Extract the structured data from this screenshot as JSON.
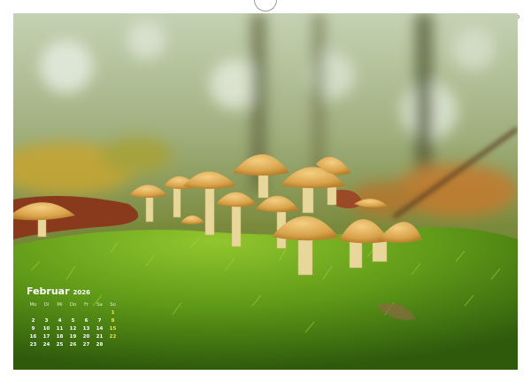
{
  "calendar": {
    "month": "Februar",
    "year": "2026",
    "weekdays": [
      "Mo",
      "Di",
      "Mi",
      "Do",
      "Fr",
      "Sa",
      "So"
    ],
    "weeks": [
      [
        "",
        "",
        "",
        "",
        "",
        "",
        "1"
      ],
      [
        "2",
        "3",
        "4",
        "5",
        "6",
        "7",
        "8"
      ],
      [
        "9",
        "10",
        "11",
        "12",
        "13",
        "14",
        "15"
      ],
      [
        "16",
        "17",
        "18",
        "19",
        "20",
        "21",
        "22"
      ],
      [
        "23",
        "24",
        "25",
        "26",
        "27",
        "28",
        ""
      ]
    ]
  },
  "colors": {
    "moss": "#4f8a12",
    "moss_light": "#8fc22e",
    "cap": "#e0aa4a",
    "stem": "#e8d79a",
    "sunday": "#e6e65a"
  },
  "photo": {
    "subject": "mushroom-cluster-on-moss"
  }
}
